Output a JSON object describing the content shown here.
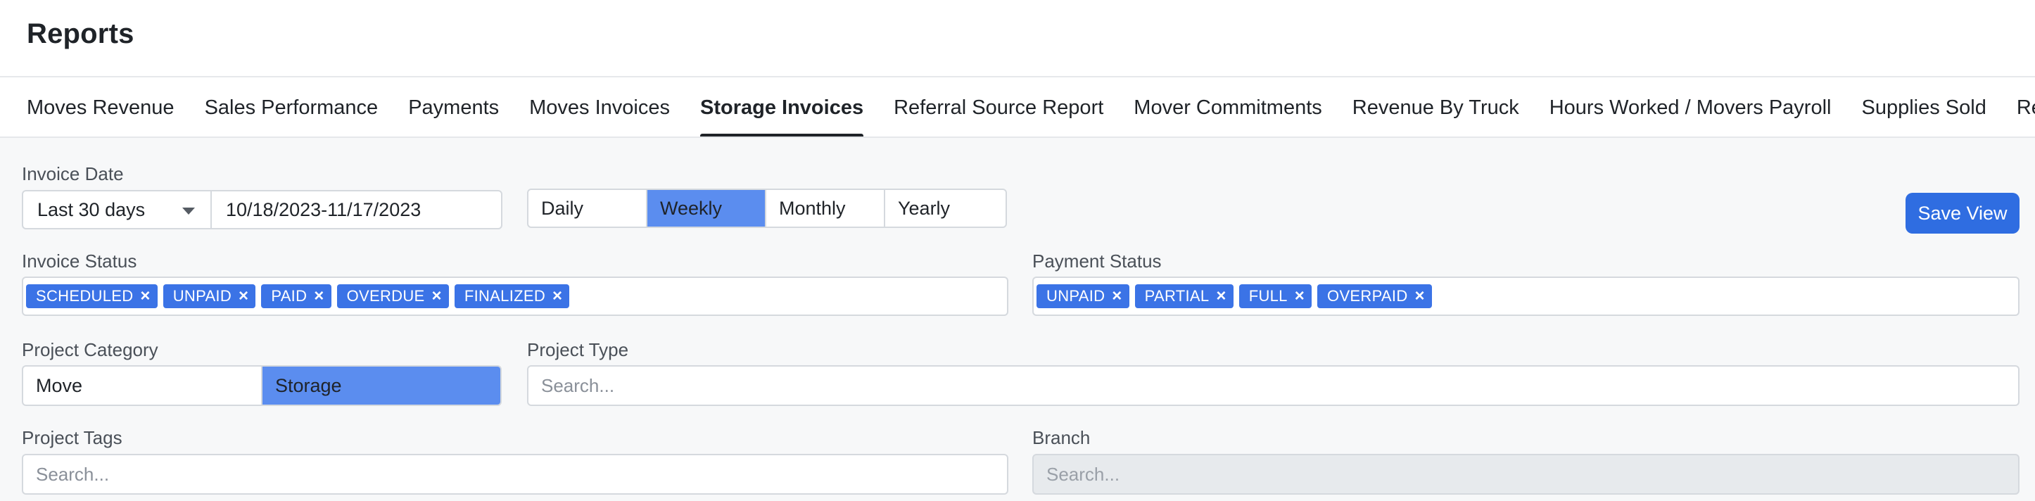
{
  "header": {
    "title": "Reports"
  },
  "tabs": [
    {
      "label": "Moves Revenue",
      "active": false
    },
    {
      "label": "Sales Performance",
      "active": false
    },
    {
      "label": "Payments",
      "active": false
    },
    {
      "label": "Moves Invoices",
      "active": false
    },
    {
      "label": "Storage Invoices",
      "active": true
    },
    {
      "label": "Referral Source Report",
      "active": false
    },
    {
      "label": "Mover Commitments",
      "active": false
    },
    {
      "label": "Revenue By Truck",
      "active": false
    },
    {
      "label": "Hours Worked / Movers Payroll",
      "active": false
    },
    {
      "label": "Supplies Sold",
      "active": false
    },
    {
      "label": "Re",
      "active": false
    }
  ],
  "filters": {
    "invoice_date": {
      "label": "Invoice Date",
      "range_select": "Last 30 days",
      "range_value": "10/18/2023-11/17/2023"
    },
    "granularity": {
      "options": [
        "Daily",
        "Weekly",
        "Monthly",
        "Yearly"
      ],
      "selected": "Weekly"
    },
    "save_view_label": "Save View",
    "invoice_status": {
      "label": "Invoice Status",
      "chips": [
        "SCHEDULED",
        "UNPAID",
        "PAID",
        "OVERDUE",
        "FINALIZED"
      ]
    },
    "payment_status": {
      "label": "Payment Status",
      "chips": [
        "UNPAID",
        "PARTIAL",
        "FULL",
        "OVERPAID"
      ]
    },
    "project_category": {
      "label": "Project Category",
      "options": [
        "Move",
        "Storage"
      ],
      "selected": "Storage"
    },
    "project_type": {
      "label": "Project Type",
      "placeholder": "Search..."
    },
    "project_tags": {
      "label": "Project Tags",
      "placeholder": "Search..."
    },
    "branch": {
      "label": "Branch",
      "placeholder": "Search..."
    }
  },
  "colors": {
    "accent": "#2f6de1",
    "chip": "#3b73e6",
    "segment_active": "#5b8def",
    "content_bg": "#f7f8f9"
  },
  "icons": {
    "chip_remove": "close-icon",
    "select_caret": "caret-down-icon"
  }
}
